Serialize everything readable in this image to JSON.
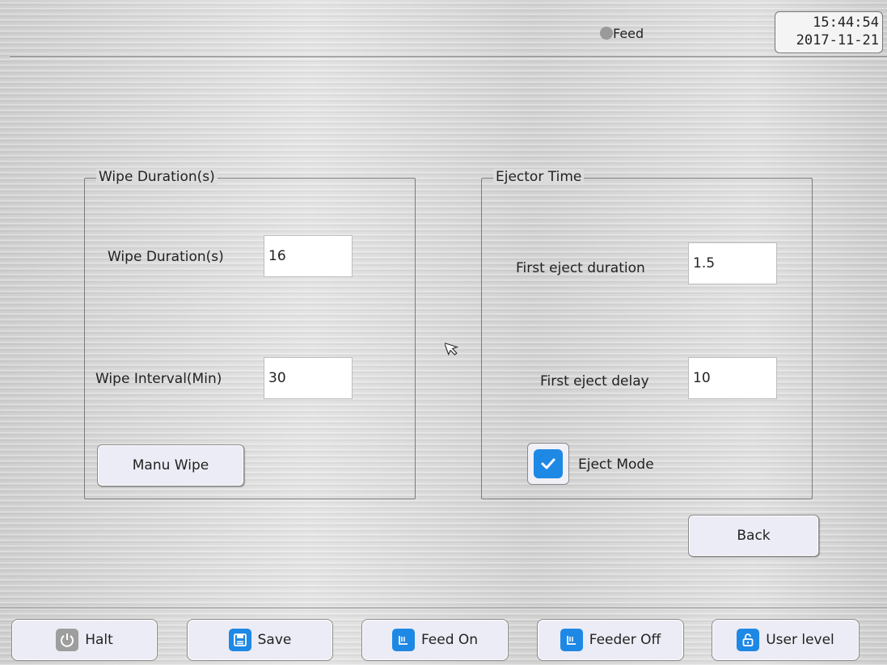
{
  "header": {
    "status_label": "Feed",
    "status_color": "#9a9a9a",
    "time": "15:44:54",
    "date": "2017-11-21"
  },
  "wipe_group": {
    "title": "Wipe Duration(s)",
    "duration_label": "Wipe Duration(s)",
    "duration_value": "16",
    "interval_label": "Wipe Interval(Min)",
    "interval_value": "30",
    "manual_button": "Manu Wipe"
  },
  "ejector_group": {
    "title": "Ejector Time",
    "first_duration_label": "First eject duration",
    "first_duration_value": "1.5",
    "first_delay_label": "First eject delay",
    "first_delay_value": "10",
    "eject_mode_label": "Eject Mode",
    "eject_mode_checked": true
  },
  "back_button": "Back",
  "toolbar": [
    {
      "label": "Halt",
      "icon": "power-icon",
      "color": "#9e9e9e"
    },
    {
      "label": "Save",
      "icon": "save-icon",
      "color": "#1e88e5"
    },
    {
      "label": "Feed On",
      "icon": "feed-icon",
      "color": "#1e88e5"
    },
    {
      "label": "Feeder Off",
      "icon": "feed-icon",
      "color": "#1e88e5"
    },
    {
      "label": "User level",
      "icon": "unlock-icon",
      "color": "#1e88e5"
    }
  ],
  "accent_color": "#1e88e5"
}
